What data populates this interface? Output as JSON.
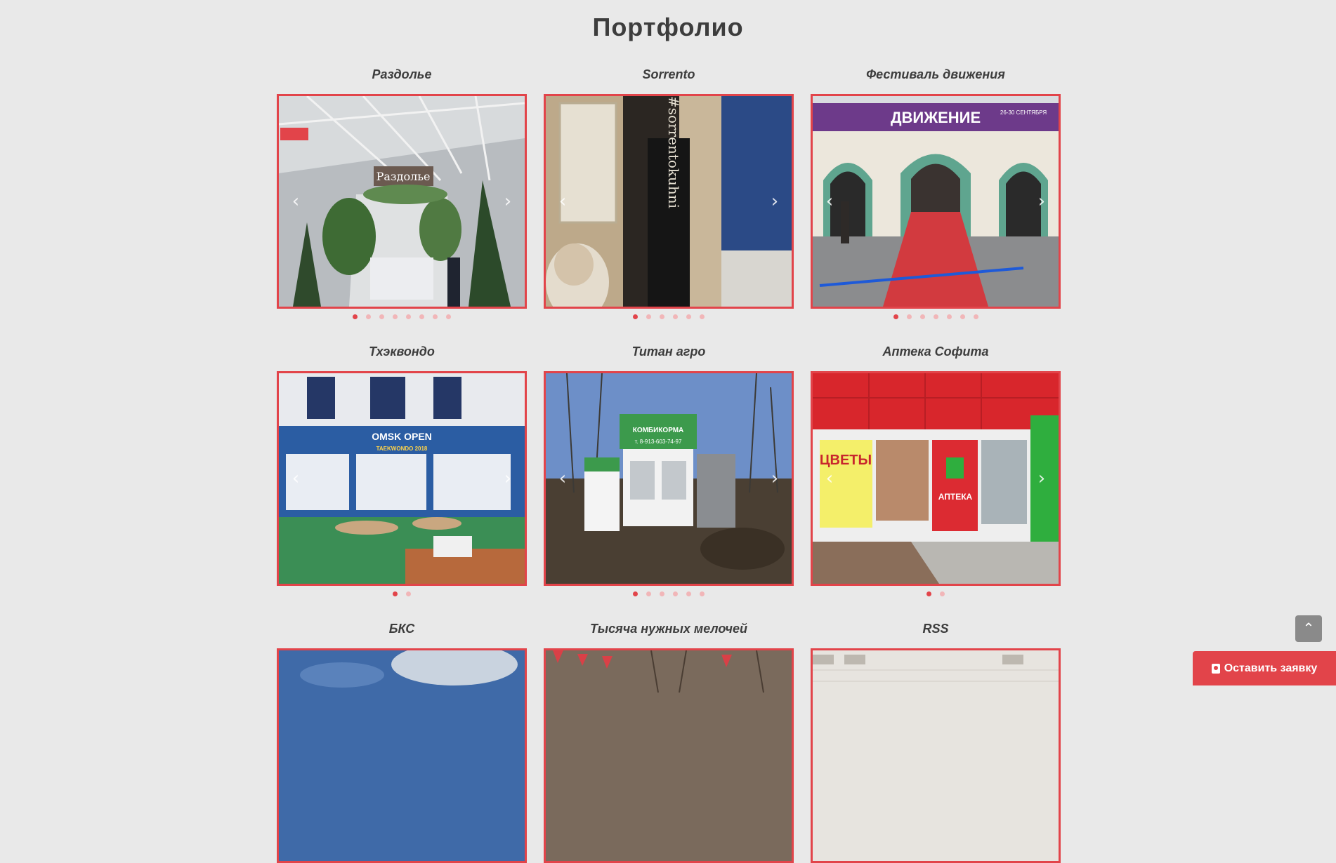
{
  "page": {
    "title": "Портфолио"
  },
  "arrows": {
    "prev": "‹",
    "next": "›"
  },
  "portfolio": [
    {
      "title": "Раздолье",
      "slide_count": 8,
      "active": 0,
      "image_text": "Раздолье"
    },
    {
      "title": "Sorrento",
      "slide_count": 6,
      "active": 0,
      "image_text": "#sorrentokuhni"
    },
    {
      "title": "Фестиваль движения",
      "slide_count": 7,
      "active": 0,
      "image_text": "ДВИЖЕНИЕ",
      "image_text_2": "26-30 СЕНТЯБРЯ"
    },
    {
      "title": "Тхэквондо",
      "slide_count": 2,
      "active": 0,
      "image_text": "OMSK OPEN",
      "image_text_2": "TAEKWONDO 2018"
    },
    {
      "title": "Титан агро",
      "slide_count": 6,
      "active": 0,
      "image_text": "КОМБИКОРМА",
      "image_text_2": "т. 8-913-603-74-97"
    },
    {
      "title": "Аптека Софита",
      "slide_count": 2,
      "active": 0,
      "image_text": "ЦВЕТЫ",
      "image_text_2": "АПТЕКА"
    },
    {
      "title": "БКС",
      "slide_count": 0,
      "active": 0
    },
    {
      "title": "Тысяча нужных мелочей",
      "slide_count": 0,
      "active": 0
    },
    {
      "title": "RSS",
      "slide_count": 0,
      "active": 0
    }
  ],
  "widgets": {
    "scroll_top_icon": "double-chevron-up-icon",
    "scroll_top_glyph": "⌃",
    "cta_label": "Оставить заявку",
    "cta_icon": "contact-card-icon"
  },
  "colors": {
    "accent": "#e2444a",
    "dot_inactive": "#f1b6b8",
    "background": "#e9e9e9",
    "text": "#3d3d3d"
  }
}
